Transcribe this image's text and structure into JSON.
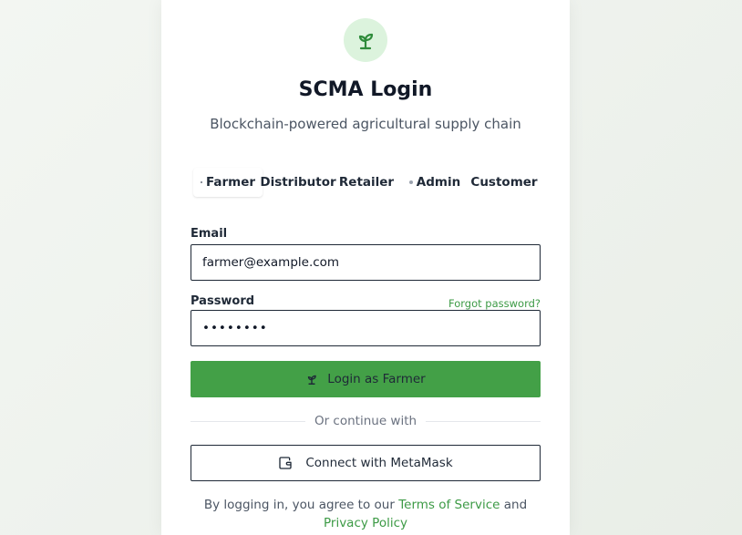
{
  "header": {
    "title": "SCMA Login",
    "subtitle": "Blockchain-powered agricultural supply chain",
    "logo_icon": "sprout-icon"
  },
  "roles": {
    "selected": "Farmer",
    "items": [
      {
        "label": "Farmer"
      },
      {
        "label": "Distributor"
      },
      {
        "label": "Retailer"
      },
      {
        "label": "Admin"
      },
      {
        "label": "Customer"
      }
    ]
  },
  "form": {
    "email_label": "Email",
    "email_value": "farmer@example.com",
    "password_label": "Password",
    "password_value": "••••••••",
    "forgot_link": "Forgot password?",
    "submit_label": "Login as Farmer",
    "divider_text": "Or continue with",
    "metamask_label": "Connect with MetaMask"
  },
  "footer": {
    "prefix": "By logging in, you agree to our",
    "terms_link": "Terms of Service",
    "and": "and",
    "privacy_link": "Privacy Policy"
  },
  "colors": {
    "accent": "#43a047",
    "link": "#3c9a45",
    "logo_bg": "#dcf3dd"
  }
}
